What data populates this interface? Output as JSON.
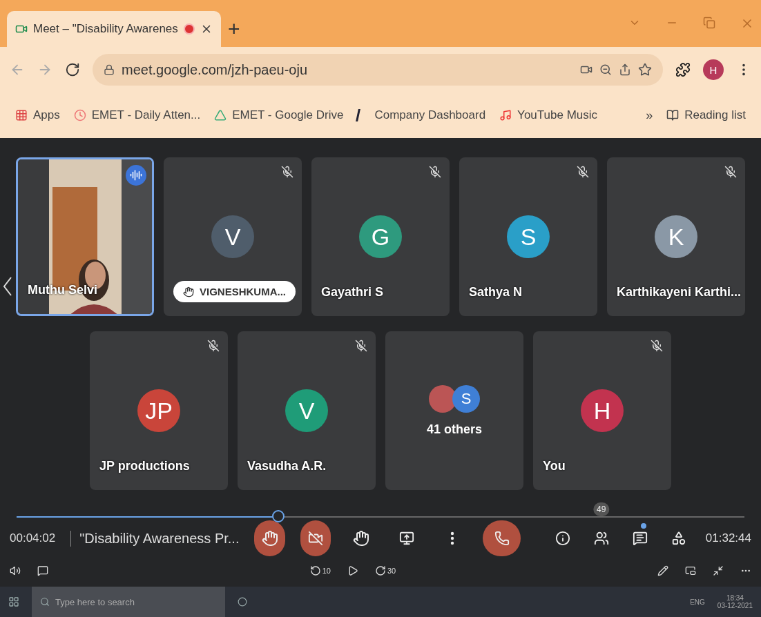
{
  "browser": {
    "tab": {
      "title": "Meet – \"Disability Awarenes",
      "recording": true
    },
    "new_tab": "+",
    "url": "meet.google.com/jzh-paeu-oju",
    "profile": "H",
    "bookmarks": [
      {
        "label": "Apps",
        "kind": "apps"
      },
      {
        "label": "EMET - Daily Atten...",
        "kind": "clock"
      },
      {
        "label": "EMET - Google Drive",
        "kind": "drive"
      },
      {
        "label": "Company Dashboard",
        "kind": "letter"
      },
      {
        "label": "YouTube Music",
        "kind": "music"
      }
    ],
    "more_bookmarks": "»",
    "reading_list": "Reading list"
  },
  "participants": [
    {
      "name": "Muthu Selvi",
      "kind": "video",
      "speaking": true,
      "muted": false,
      "hand_raised": false
    },
    {
      "name": "VIGNESHKUMA...",
      "kind": "avatar",
      "initial": "V",
      "color": "#4f5d6b",
      "muted": true,
      "hand_raised": true,
      "speaking": false
    },
    {
      "name": "Gayathri S",
      "kind": "avatar",
      "initial": "G",
      "color": "#2e9a7e",
      "muted": true,
      "hand_raised": false,
      "speaking": false
    },
    {
      "name": "Sathya N",
      "kind": "avatar",
      "initial": "S",
      "color": "#2a9fc8",
      "muted": true,
      "hand_raised": false,
      "speaking": false
    },
    {
      "name": "Karthikayeni Karthi...",
      "kind": "avatar",
      "initial": "K",
      "color": "#8a98a6",
      "muted": true,
      "hand_raised": false,
      "speaking": false
    },
    {
      "name": "JP productions",
      "kind": "avatar",
      "initial": "JP",
      "color": "#c9453a",
      "muted": true,
      "hand_raised": false,
      "speaking": false
    },
    {
      "name": "Vasudha A.R.",
      "kind": "avatar",
      "initial": "V",
      "color": "#1f9c78",
      "muted": true,
      "hand_raised": false,
      "speaking": false
    },
    {
      "name": "41 others",
      "kind": "others",
      "initial": "S",
      "color": "#3f7fd6",
      "muted": false,
      "hand_raised": false,
      "speaking": false
    },
    {
      "name": "You",
      "kind": "avatar",
      "initial": "H",
      "color": "#c2334f",
      "muted": true,
      "hand_raised": false,
      "speaking": false
    }
  ],
  "meeting_title": "\"Disability Awareness Pr...",
  "people_count": "49",
  "player": {
    "elapsed": "00:04:02",
    "duration": "01:32:44",
    "level": 0.36,
    "rewind": "10",
    "forward": "30"
  },
  "taskbar": {
    "search_placeholder": "Type here to search",
    "language": "ENG",
    "time": "18:34",
    "date": "03-12-2021"
  }
}
